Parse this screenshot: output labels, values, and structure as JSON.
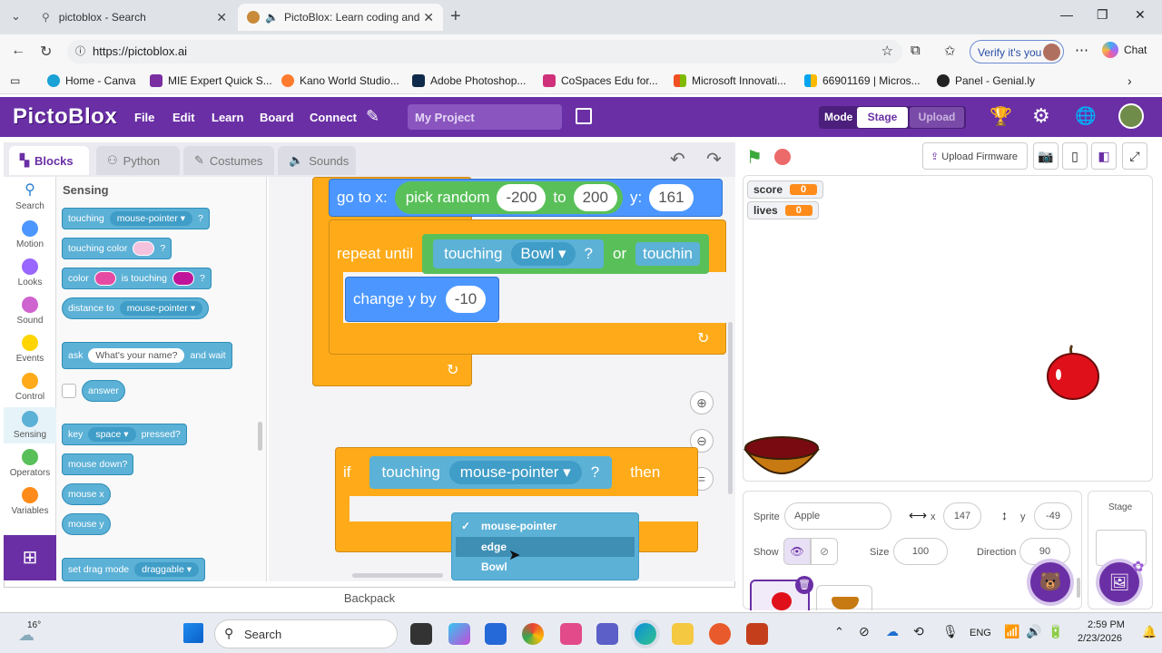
{
  "browser": {
    "tabs": [
      {
        "title": "pictoblox - Search",
        "active": false
      },
      {
        "title": "PictoBlox: Learn coding and p",
        "active": true
      }
    ],
    "url": "https://pictoblox.ai",
    "verify_label": "Verify it's you",
    "chat_label": "Chat",
    "bookmarks": [
      "Home - Canva",
      "MIE Expert Quick S...",
      "Kano World Studio...",
      "Adobe Photoshop...",
      "CoSpaces Edu for...",
      "Microsoft Innovati...",
      "66901169 | Micros...",
      "Panel - Genial.ly"
    ]
  },
  "app": {
    "logo": "PictoBlox",
    "menu": [
      "File",
      "Edit",
      "Learn",
      "Board",
      "Connect"
    ],
    "project_name": "My Project",
    "mode_label": "Mode",
    "mode_options": [
      "Stage",
      "Upload"
    ],
    "upload_firmware": "Upload Firmware"
  },
  "editor_tabs": [
    "Blocks",
    "Python",
    "Costumes",
    "Sounds"
  ],
  "categories": [
    {
      "label": "Search",
      "color": "#2a7fd4"
    },
    {
      "label": "Motion",
      "color": "#4c97ff"
    },
    {
      "label": "Looks",
      "color": "#9966ff"
    },
    {
      "label": "Sound",
      "color": "#cf63cf"
    },
    {
      "label": "Events",
      "color": "#ffd500"
    },
    {
      "label": "Control",
      "color": "#ffab19"
    },
    {
      "label": "Sensing",
      "color": "#5cb1d6"
    },
    {
      "label": "Operators",
      "color": "#59c059"
    },
    {
      "label": "Variables",
      "color": "#ff8c1a"
    }
  ],
  "palette": {
    "heading": "Sensing",
    "touching": "touching",
    "touching_target": "mouse-pointer",
    "q": "?",
    "touching_color": "touching color",
    "color_label": "color",
    "is_touching": "is touching",
    "distance_to": "distance to",
    "distance_target": "mouse-pointer",
    "ask": "ask",
    "ask_default": "What's your name?",
    "and_wait": "and wait",
    "answer": "answer",
    "key": "key",
    "key_value": "space",
    "pressed": "pressed?",
    "mouse_down": "mouse down?",
    "mouse_x": "mouse x",
    "mouse_y": "mouse y",
    "set_drag_mode": "set drag mode",
    "drag_value": "draggable"
  },
  "script": {
    "go_to_x": "go to x:",
    "pick_random": "pick random",
    "rand_from": "-200",
    "to": "to",
    "rand_to": "200",
    "y_label": "y:",
    "y_value": "161",
    "repeat_until": "repeat until",
    "touching": "touching",
    "bowl": "Bowl",
    "q": "?",
    "or": "or",
    "touching_cut": "touchin",
    "change_y_by": "change y by",
    "change_value": "-10",
    "if": "if",
    "touching2": "touching",
    "mouse_pointer": "mouse-pointer",
    "then": "then"
  },
  "dropdown": {
    "items": [
      "mouse-pointer",
      "edge",
      "Bowl"
    ],
    "checked": "mouse-pointer",
    "hovered": "edge",
    "check_mark": "✓"
  },
  "backpack": "Backpack",
  "stage": {
    "monitors": [
      {
        "label": "score",
        "value": "0"
      },
      {
        "label": "lives",
        "value": "0"
      }
    ]
  },
  "sprite_panel": {
    "sprite_label": "Sprite",
    "sprite_name": "Apple",
    "x_label": "x",
    "x_value": "147",
    "y_label": "y",
    "y_value": "-49",
    "show_label": "Show",
    "size_label": "Size",
    "size_value": "100",
    "direction_label": "Direction",
    "direction_value": "90"
  },
  "stage_panel": {
    "label": "Stage"
  },
  "taskbar": {
    "temp": "16°",
    "search": "Search",
    "lang": "ENG",
    "time": "2:59 PM",
    "date": "2/23/2026"
  }
}
